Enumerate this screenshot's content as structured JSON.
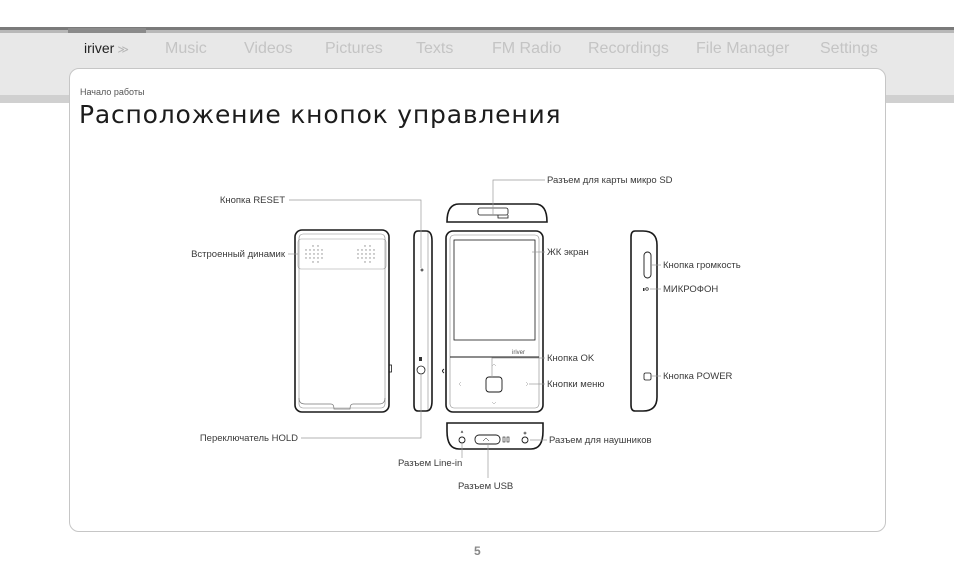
{
  "nav": {
    "items": [
      {
        "label": "iriver",
        "active": true,
        "suffix": "≫"
      },
      {
        "label": "Music",
        "active": false
      },
      {
        "label": "Videos",
        "active": false
      },
      {
        "label": "Pictures",
        "active": false
      },
      {
        "label": "Texts",
        "active": false
      },
      {
        "label": "FM Radio",
        "active": false
      },
      {
        "label": "Recordings",
        "active": false
      },
      {
        "label": "File Manager",
        "active": false
      },
      {
        "label": "Settings",
        "active": false
      }
    ]
  },
  "page": {
    "breadcrumb": "Начало работы",
    "title": "Расположение кнопок управления",
    "page_number": "5"
  },
  "diagram": {
    "labels": {
      "reset": "Кнопка RESET",
      "speaker": "Встроенный динамик",
      "hold": "Переключатель HOLD",
      "microsd": "Разъем для карты микро SD",
      "lcd": "ЖК экран",
      "ok": "Кнопка OK",
      "menu": "Кнопки меню",
      "headphones": "Разъем для наушников",
      "linein": "Разъем Line-in",
      "usb": "Разъем USB",
      "volume": "Кнопка громкость",
      "mic": "МИКРОФОН",
      "power": "Кнопка POWER"
    },
    "brand_on_device": "iriver"
  }
}
